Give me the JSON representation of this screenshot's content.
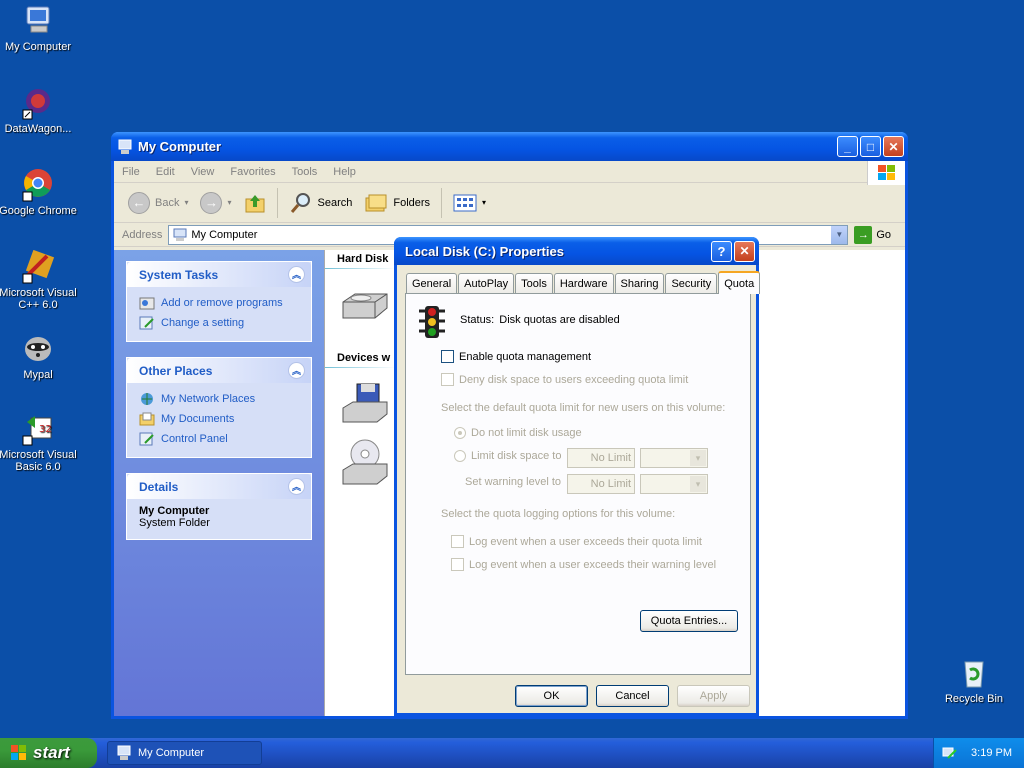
{
  "desktop": {
    "icons": [
      {
        "label": "My Computer"
      },
      {
        "label": "DataWagon..."
      },
      {
        "label": "Google Chrome"
      },
      {
        "label": "Microsoft Visual C++ 6.0"
      },
      {
        "label": "Mypal"
      },
      {
        "label": "Microsoft Visual Basic 6.0"
      },
      {
        "label": "Recycle Bin"
      }
    ]
  },
  "explorer": {
    "title": "My Computer",
    "menu": [
      "File",
      "Edit",
      "View",
      "Favorites",
      "Tools",
      "Help"
    ],
    "toolbar": {
      "back": "Back",
      "search": "Search",
      "folders": "Folders"
    },
    "address_label": "Address",
    "address_value": "My Computer",
    "go": "Go",
    "tasks": {
      "system_title": "System Tasks",
      "system_items": [
        "Add or remove programs",
        "Change a setting"
      ],
      "places_title": "Other Places",
      "places_items": [
        "My Network Places",
        "My Documents",
        "Control Panel"
      ],
      "details_title": "Details",
      "details_name": "My Computer",
      "details_type": "System Folder"
    },
    "sections": {
      "hard_disks": "Hard Disk",
      "devices": "Devices w"
    }
  },
  "dialog": {
    "title": "Local Disk (C:) Properties",
    "tabs": [
      "General",
      "AutoPlay",
      "Tools",
      "Hardware",
      "Sharing",
      "Security",
      "Quota"
    ],
    "status_label": "Status:",
    "status_value": "Disk quotas are disabled",
    "enable_quota": "Enable quota management",
    "deny_space": "Deny disk space to users exceeding quota limit",
    "default_limit_label": "Select the default quota limit for new users on this volume:",
    "no_limit_radio": "Do not limit disk usage",
    "limit_radio": "Limit disk space to",
    "warning_label": "Set warning level to",
    "limit_value": "No Limit",
    "warning_value": "No Limit",
    "logging_label": "Select the quota logging options for this volume:",
    "log_limit": "Log event when a user exceeds their quota limit",
    "log_warning": "Log event when a user exceeds their warning level",
    "quota_entries": "Quota Entries...",
    "ok": "OK",
    "cancel": "Cancel",
    "apply": "Apply"
  },
  "taskbar": {
    "start": "start",
    "task_label": "My Computer",
    "clock": "3:19 PM"
  }
}
